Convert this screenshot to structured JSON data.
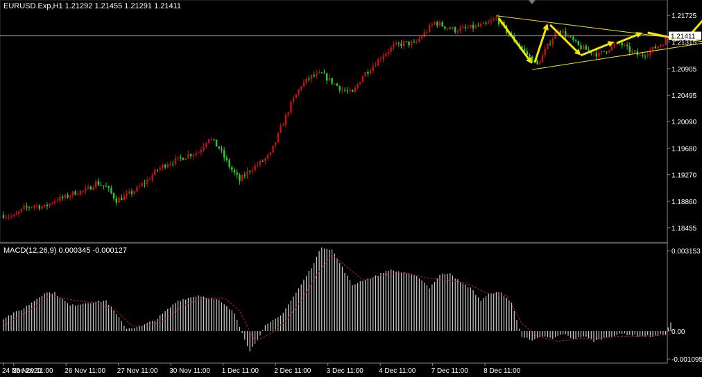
{
  "chart_data": {
    "type": "candlestick",
    "title": "EURUSD.Exp,H1  1.21292 1.21455 1.21291 1.21411",
    "current_price": "1.21411",
    "colors": {
      "bull": "#c81010",
      "bear": "#22d122",
      "grid": "#9a9a9a",
      "accent": "#f5e600",
      "axis_text": "#ffffff",
      "signal": "#c21b1b",
      "hist": "#cfcfcf"
    },
    "ylim": [
      1.1825,
      1.2192
    ],
    "y_ticks": [
      "1.21725",
      "1.21315",
      "1.20905",
      "1.20495",
      "1.20090",
      "1.19680",
      "1.19270",
      "1.18860",
      "1.18455"
    ],
    "x_ticks": [
      "24 Nov 2020",
      "25 Nov 11:00",
      "26 Nov 11:00",
      "27 Nov 11:00",
      "30 Nov 11:00",
      "1 Dec 11:00",
      "2 Dec 11:00",
      "3 Dec 11:00",
      "4 Dec 11:00",
      "7 Dec 11:00",
      "8 Dec 11:00"
    ],
    "close_path": [
      [
        0,
        1.1865
      ],
      [
        4,
        1.1862
      ],
      [
        8,
        1.1875
      ],
      [
        12,
        1.188
      ],
      [
        16,
        1.1877
      ],
      [
        20,
        1.1888
      ],
      [
        24,
        1.1892
      ],
      [
        28,
        1.19
      ],
      [
        32,
        1.1902
      ],
      [
        36,
        1.1915
      ],
      [
        40,
        1.1908
      ],
      [
        44,
        1.1888
      ],
      [
        48,
        1.1895
      ],
      [
        52,
        1.1905
      ],
      [
        56,
        1.1918
      ],
      [
        60,
        1.1935
      ],
      [
        64,
        1.1945
      ],
      [
        68,
        1.195
      ],
      [
        72,
        1.1958
      ],
      [
        76,
        1.1962
      ],
      [
        80,
        1.1985
      ],
      [
        84,
        1.1968
      ],
      [
        88,
        1.194
      ],
      [
        92,
        1.1918
      ],
      [
        96,
        1.1935
      ],
      [
        100,
        1.1945
      ],
      [
        104,
        1.1958
      ],
      [
        108,
        1.1998
      ],
      [
        112,
        1.2035
      ],
      [
        116,
        1.2065
      ],
      [
        120,
        1.2078
      ],
      [
        124,
        1.2082
      ],
      [
        128,
        1.207
      ],
      [
        132,
        1.2058
      ],
      [
        136,
        1.2052
      ],
      [
        140,
        1.208
      ],
      [
        144,
        1.2095
      ],
      [
        148,
        1.2112
      ],
      [
        152,
        1.2125
      ],
      [
        156,
        1.213
      ],
      [
        160,
        1.2128
      ],
      [
        164,
        1.2145
      ],
      [
        168,
        1.2162
      ],
      [
        172,
        1.2155
      ],
      [
        176,
        1.215
      ],
      [
        180,
        1.2152
      ],
      [
        184,
        1.2155
      ],
      [
        188,
        1.2158
      ],
      [
        192,
        1.2168
      ],
      [
        196,
        1.2148
      ],
      [
        200,
        1.213
      ],
      [
        204,
        1.2112
      ],
      [
        208,
        1.2096
      ],
      [
        212,
        1.2125
      ],
      [
        216,
        1.2152
      ],
      [
        220,
        1.214
      ],
      [
        224,
        1.2125
      ],
      [
        228,
        1.2118
      ],
      [
        232,
        1.2112
      ],
      [
        236,
        1.2122
      ],
      [
        240,
        1.213
      ],
      [
        244,
        1.2118
      ],
      [
        248,
        1.211
      ],
      [
        252,
        1.2118
      ],
      [
        256,
        1.2128
      ],
      [
        260,
        1.2141
      ]
    ],
    "trendlines": [
      {
        "p1": [
          192,
          1.2172
        ],
        "p2": [
          273,
          1.2132
        ]
      },
      {
        "p1": [
          206,
          1.2089
        ],
        "p2": [
          273,
          1.213
        ]
      }
    ],
    "arrows": [
      {
        "from": [
          193,
          1.2168
        ],
        "to": [
          206,
          1.2098
        ]
      },
      {
        "from": [
          207,
          1.21
        ],
        "to": [
          212,
          1.216
        ]
      },
      {
        "from": [
          213,
          1.2158
        ],
        "to": [
          225,
          1.2111
        ]
      },
      {
        "from": [
          225,
          1.2111
        ],
        "to": [
          238,
          1.2132
        ]
      },
      {
        "from": [
          239,
          1.213
        ],
        "to": [
          249,
          1.2146
        ]
      },
      {
        "from": [
          251,
          1.2146
        ],
        "to": [
          264,
          1.2135
        ]
      },
      {
        "from": [
          266,
          1.2136
        ],
        "to": [
          279,
          1.2194
        ]
      }
    ],
    "macd": {
      "title": "MACD(12,26,9) 0.000345 -0.000127",
      "ylim": [
        -0.0012,
        0.0034
      ],
      "y_ticks": [
        "0.003153",
        "0.00",
        "-0.001095"
      ],
      "hist_path": [
        [
          0,
          0.0005
        ],
        [
          8,
          0.0009
        ],
        [
          16,
          0.0015
        ],
        [
          20,
          0.0015
        ],
        [
          26,
          0.001
        ],
        [
          32,
          0.0011
        ],
        [
          40,
          0.0012
        ],
        [
          48,
          0.0001
        ],
        [
          54,
          0.0002
        ],
        [
          60,
          0.0005
        ],
        [
          68,
          0.0012
        ],
        [
          76,
          0.0014
        ],
        [
          84,
          0.0012
        ],
        [
          90,
          0.0007
        ],
        [
          96,
          -0.0008
        ],
        [
          102,
          0.0002
        ],
        [
          108,
          0.0006
        ],
        [
          114,
          0.0015
        ],
        [
          120,
          0.0025
        ],
        [
          124,
          0.0033
        ],
        [
          128,
          0.0032
        ],
        [
          132,
          0.0025
        ],
        [
          136,
          0.0018
        ],
        [
          140,
          0.002
        ],
        [
          144,
          0.0021
        ],
        [
          150,
          0.0024
        ],
        [
          156,
          0.0023
        ],
        [
          162,
          0.0021
        ],
        [
          166,
          0.0017
        ],
        [
          170,
          0.0022
        ],
        [
          174,
          0.0023
        ],
        [
          178,
          0.0019
        ],
        [
          182,
          0.0017
        ],
        [
          186,
          0.0012
        ],
        [
          190,
          0.0015
        ],
        [
          194,
          0.0015
        ],
        [
          198,
          0.0011
        ],
        [
          202,
          -0.0002
        ],
        [
          206,
          -0.0004
        ],
        [
          210,
          -0.0002
        ],
        [
          214,
          -0.0003
        ],
        [
          218,
          -0.0001
        ],
        [
          222,
          -0.0003
        ],
        [
          226,
          -0.0002
        ],
        [
          230,
          -0.0004
        ],
        [
          236,
          -0.0002
        ],
        [
          242,
          -0.0001
        ],
        [
          248,
          -0.0002
        ],
        [
          254,
          -0.0002
        ],
        [
          258,
          -0.0001
        ],
        [
          260,
          0.000345
        ]
      ],
      "signal_path": [
        [
          0,
          0.0002
        ],
        [
          10,
          0.0008
        ],
        [
          18,
          0.0014
        ],
        [
          28,
          0.0012
        ],
        [
          36,
          0.0011
        ],
        [
          44,
          0.0008
        ],
        [
          50,
          0.0002
        ],
        [
          56,
          0.0002
        ],
        [
          62,
          0.0004
        ],
        [
          70,
          0.001
        ],
        [
          78,
          0.0013
        ],
        [
          86,
          0.0013
        ],
        [
          92,
          0.0008
        ],
        [
          98,
          -0.0004
        ],
        [
          104,
          -0.0001
        ],
        [
          110,
          0.0004
        ],
        [
          116,
          0.0012
        ],
        [
          122,
          0.0022
        ],
        [
          128,
          0.003
        ],
        [
          134,
          0.0025
        ],
        [
          140,
          0.002
        ],
        [
          148,
          0.0022
        ],
        [
          156,
          0.0023
        ],
        [
          164,
          0.0021
        ],
        [
          172,
          0.002
        ],
        [
          180,
          0.0019
        ],
        [
          188,
          0.0015
        ],
        [
          196,
          0.0014
        ],
        [
          202,
          0.0003
        ],
        [
          208,
          -0.0002
        ],
        [
          216,
          -0.0004
        ],
        [
          224,
          -0.0003
        ],
        [
          232,
          -0.0003
        ],
        [
          240,
          -0.0002
        ],
        [
          250,
          -0.0002
        ],
        [
          260,
          -0.000127
        ]
      ]
    }
  }
}
